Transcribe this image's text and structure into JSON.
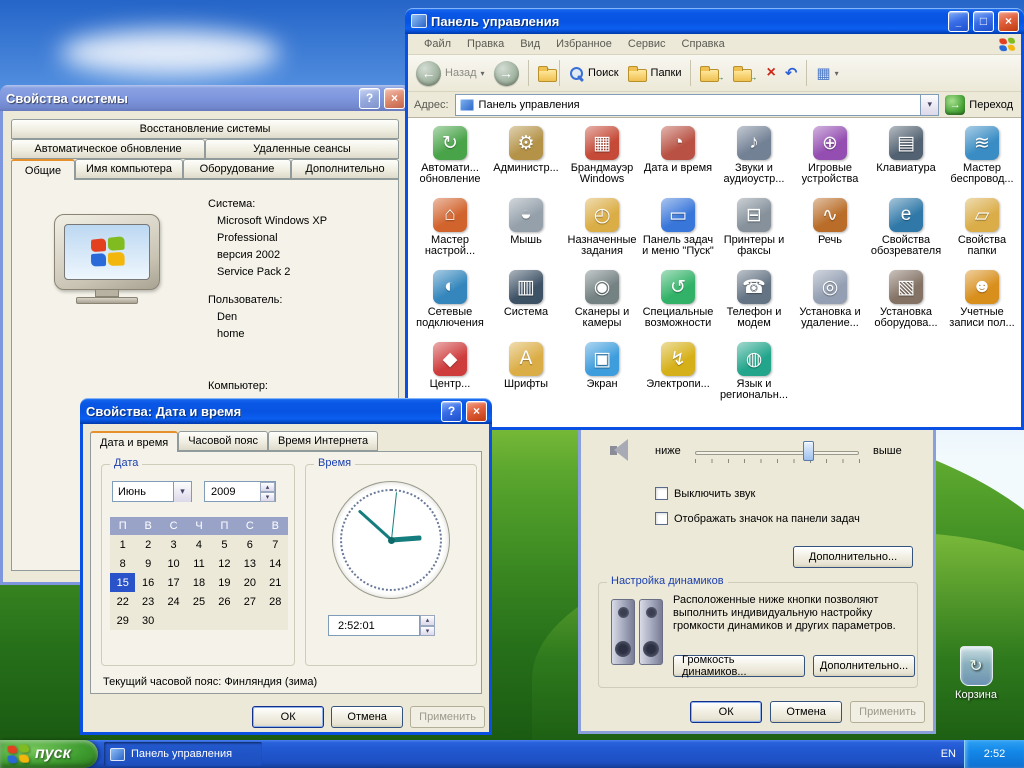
{
  "window_controls": {
    "minimize": "_",
    "maximize": "□",
    "close": "×",
    "help": "?"
  },
  "icons": {
    "dropdown": "▾",
    "spin_up": "▴",
    "spin_down": "▾",
    "back_arrow": "←",
    "forward_arrow": "→",
    "up_arrow": "↑",
    "go_arrow": "→",
    "delete_glyph": "×",
    "undo_glyph": "↶",
    "views_glyph": "▦",
    "recycle_glyph": "↻"
  },
  "desktop": {
    "recycle_bin_label": "Корзина"
  },
  "taskbar": {
    "start_label": "пуск",
    "task_button_label": "Панель управления",
    "language_indicator": "EN",
    "clock": "2:52"
  },
  "control_panel": {
    "title": "Панель управления",
    "menu_items": [
      "Файл",
      "Правка",
      "Вид",
      "Избранное",
      "Сервис",
      "Справка"
    ],
    "toolbar": {
      "back_label": "Назад",
      "search_label": "Поиск",
      "folders_label": "Папки"
    },
    "address_bar": {
      "label": "Адрес:",
      "value": "Панель управления",
      "go_label": "Переход"
    },
    "items": [
      {
        "label": "Автомати... обновление",
        "icon": "auto-update-icon",
        "glyph": "↻",
        "color": "#3f9e3f"
      },
      {
        "label": "Администр...",
        "icon": "admin-tools-icon",
        "glyph": "⚙",
        "color": "#b08d3e"
      },
      {
        "label": "Брандмауэр Windows",
        "icon": "firewall-icon",
        "glyph": "▦",
        "color": "#c2402c"
      },
      {
        "label": "Дата и время",
        "icon": "date-time-icon",
        "glyph": "◔",
        "color": "#b5493a"
      },
      {
        "label": "Звуки и аудиоустр...",
        "icon": "sounds-audio-icon",
        "glyph": "♪",
        "color": "#6b7a8f"
      },
      {
        "label": "Игровые устройства",
        "icon": "game-controllers-icon",
        "glyph": "⊕",
        "color": "#8e44ad"
      },
      {
        "label": "Клавиатура",
        "icon": "keyboard-icon",
        "glyph": "▤",
        "color": "#4a5a6a"
      },
      {
        "label": "Мастер беспровод...",
        "icon": "wireless-wizard-icon",
        "glyph": "≋",
        "color": "#2e86c1"
      },
      {
        "label": "Мастер настрой...",
        "icon": "network-setup-wizard-icon",
        "glyph": "⌂",
        "color": "#cf5b22"
      },
      {
        "label": "Мышь",
        "icon": "mouse-icon",
        "glyph": "◒",
        "color": "#8f9ba6"
      },
      {
        "label": "Назначенные задания",
        "icon": "scheduled-tasks-icon",
        "glyph": "◴",
        "color": "#d9a93c"
      },
      {
        "label": "Панель задач и меню \"Пуск\"",
        "icon": "taskbar-start-menu-icon",
        "glyph": "▭",
        "color": "#2e6fd8"
      },
      {
        "label": "Принтеры и факсы",
        "icon": "printers-faxes-icon",
        "glyph": "⊟",
        "color": "#7f8b96"
      },
      {
        "label": "Речь",
        "icon": "speech-icon",
        "glyph": "∿",
        "color": "#b5651d"
      },
      {
        "label": "Свойства обозревателя",
        "icon": "internet-options-icon",
        "glyph": "e",
        "color": "#2471a3"
      },
      {
        "label": "Свойства папки",
        "icon": "folder-options-icon",
        "glyph": "▱",
        "color": "#d8a93f"
      },
      {
        "label": "Сетевые подключения",
        "icon": "network-connections-icon",
        "glyph": "◐",
        "color": "#2980b9"
      },
      {
        "label": "Система",
        "icon": "system-icon",
        "glyph": "▥",
        "color": "#34495e"
      },
      {
        "label": "Сканеры и камеры",
        "icon": "scanners-cameras-icon",
        "glyph": "◉",
        "color": "#6d7b7c"
      },
      {
        "label": "Специальные возможности",
        "icon": "accessibility-icon",
        "glyph": "↺",
        "color": "#27ae60"
      },
      {
        "label": "Телефон и модем",
        "icon": "phone-modem-icon",
        "glyph": "☎",
        "color": "#5d6d7e"
      },
      {
        "label": "Установка и удаление...",
        "icon": "add-remove-programs-icon",
        "glyph": "◎",
        "color": "#8e9aaf"
      },
      {
        "label": "Установка оборудова...",
        "icon": "add-hardware-icon",
        "glyph": "▧",
        "color": "#7d6b5d"
      },
      {
        "label": "Учетные записи пол...",
        "icon": "user-accounts-icon",
        "glyph": "☻",
        "color": "#d68910"
      },
      {
        "label": "Центр...",
        "icon": "security-center-icon",
        "glyph": "◆",
        "color": "#cc3333"
      },
      {
        "label": "Шрифты",
        "icon": "fonts-icon",
        "glyph": "A",
        "color": "#d9a93c"
      },
      {
        "label": "Экран",
        "icon": "display-icon",
        "glyph": "▣",
        "color": "#3498db"
      },
      {
        "label": "Электропи...",
        "icon": "power-options-icon",
        "glyph": "↯",
        "color": "#d4ac0d"
      },
      {
        "label": "Язык и региональн...",
        "icon": "regional-language-icon",
        "glyph": "◍",
        "color": "#16a085"
      }
    ]
  },
  "system_properties": {
    "title": "Свойства системы",
    "tabs_row1": [
      "Восстановление системы"
    ],
    "tabs_row2": [
      "Автоматическое обновление",
      "Удаленные сеансы"
    ],
    "tabs_row3": [
      "Общие",
      "Имя компьютера",
      "Оборудование",
      "Дополнительно"
    ],
    "active_tab": "Общие",
    "system_label": "Система:",
    "system_lines": [
      "Microsoft Windows XP",
      "Professional",
      "версия 2002",
      "Service Pack 2"
    ],
    "user_label": "Пользователь:",
    "user_lines": [
      "Den",
      "home"
    ],
    "computer_label": "Компьютер:"
  },
  "datetime_dialog": {
    "title": "Свойства: Дата и время",
    "tabs": [
      "Дата и время",
      "Часовой пояс",
      "Время Интернета"
    ],
    "active_tab": "Дата и время",
    "date_group_label": "Дата",
    "time_group_label": "Время",
    "month_value": "Июнь",
    "year_value": "2009",
    "day_headers": [
      "П",
      "В",
      "С",
      "Ч",
      "П",
      "С",
      "В"
    ],
    "weeks": [
      [
        "1",
        "2",
        "3",
        "4",
        "5",
        "6",
        "7"
      ],
      [
        "8",
        "9",
        "10",
        "11",
        "12",
        "13",
        "14"
      ],
      [
        "15",
        "16",
        "17",
        "18",
        "19",
        "20",
        "21"
      ],
      [
        "22",
        "23",
        "24",
        "25",
        "26",
        "27",
        "28"
      ],
      [
        "29",
        "30",
        "",
        "",
        "",
        "",
        ""
      ]
    ],
    "selected_day": "15",
    "time_value": "2:52:01",
    "timezone_text": "Текущий часовой пояс: Финляндия (зима)",
    "ok_label": "ОК",
    "cancel_label": "Отмена",
    "apply_label": "Применить"
  },
  "sound_dialog": {
    "low_label": "ниже",
    "high_label": "выше",
    "mute_label": "Выключить звук",
    "tray_icon_label": "Отображать значок на панели задач",
    "advanced_label": "Дополнительно...",
    "speaker_group_label": "Настройка динамиков",
    "speaker_group_text": "Расположенные ниже кнопки позволяют выполнить индив­идуальную настройку громкости динамиков и других параметров.",
    "speaker_volume_label": "Громкость динамиков...",
    "speaker_advanced_label": "Дополнительно...",
    "ok_label": "ОК",
    "cancel_label": "Отмена",
    "apply_label": "Применить"
  }
}
